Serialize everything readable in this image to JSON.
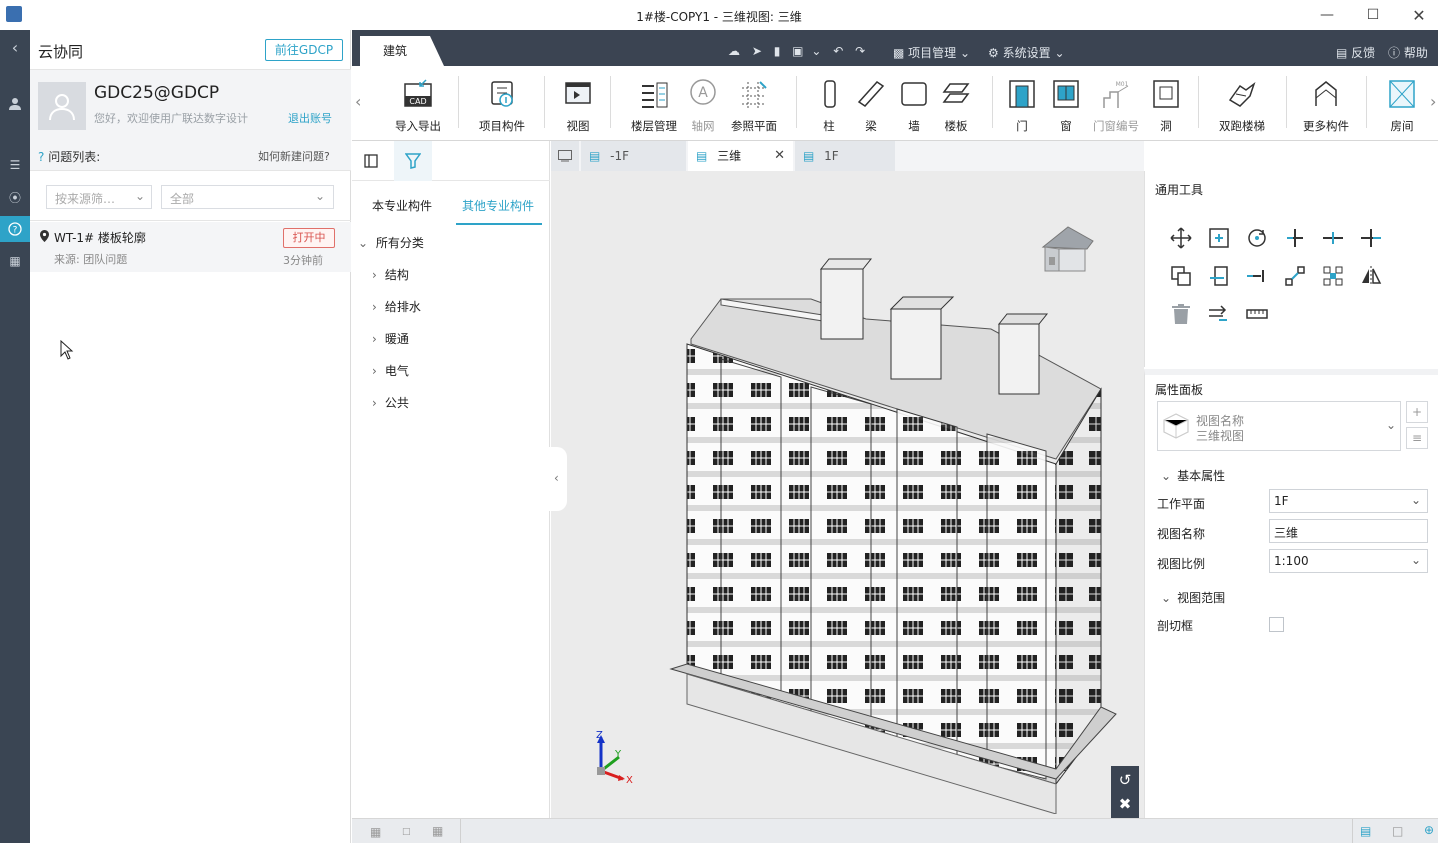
{
  "window": {
    "title": "1#楼-COPY1 - 三维视图: 三维"
  },
  "cloud": {
    "title": "云协同",
    "goto_button": "前往GDCP",
    "username": "GDC25@GDCP",
    "welcome": "您好，欢迎使用广联达数字设计",
    "logout": "退出账号",
    "issue_list_label": "问题列表:",
    "how_to_new": "如何新建问题?",
    "filter_source_placeholder": "按来源筛…",
    "filter_status_value": "全部",
    "issues": [
      {
        "title": "WT-1# 楼板轮廓",
        "source": "来源: 团队问题",
        "status": "打开中",
        "time": "3分钟前"
      }
    ]
  },
  "toolbar": {
    "active_tab": "建筑",
    "project_menu": "项目管理",
    "settings_menu": "系统设置",
    "feedback": "反馈",
    "help": "帮助",
    "buttons": {
      "import_export": "导入导出",
      "project_components": "项目构件",
      "view": "视图",
      "floor_mgmt": "楼层管理",
      "grid": "轴网",
      "ref_plane": "参照平面",
      "column": "柱",
      "beam": "梁",
      "wall": "墙",
      "slab": "楼板",
      "door": "门",
      "window": "窗",
      "door_window_no": "门窗编号",
      "opening": "洞",
      "double_stair": "双跑楼梯",
      "more": "更多构件",
      "room": "房间"
    },
    "cad_label": "CAD",
    "door_window_tag": "M01"
  },
  "components": {
    "tab_own": "本专业构件",
    "tab_other": "其他专业构件",
    "tree_root": "所有分类",
    "categories": [
      "结构",
      "给排水",
      "暖通",
      "电气",
      "公共"
    ]
  },
  "view_tabs": [
    "-1F",
    "三维",
    "1F"
  ],
  "general_tools_title": "通用工具",
  "properties": {
    "title": "属性面板",
    "view_name_label": "视图名称",
    "view_name_value": "三维视图",
    "basic_section": "基本属性",
    "work_plane_label": "工作平面",
    "work_plane_value": "1F",
    "view_name_field_label": "视图名称",
    "view_name_field_value": "三维",
    "scale_label": "视图比例",
    "scale_value": "1:100",
    "range_section": "视图范围",
    "section_box_label": "剖切框"
  },
  "axis": {
    "x": "X",
    "y": "Y",
    "z": "Z"
  },
  "colors": {
    "accent": "#2ea3c8",
    "rail": "#3a4553",
    "toolbar": "#3b4452",
    "danger": "#d9534f"
  }
}
